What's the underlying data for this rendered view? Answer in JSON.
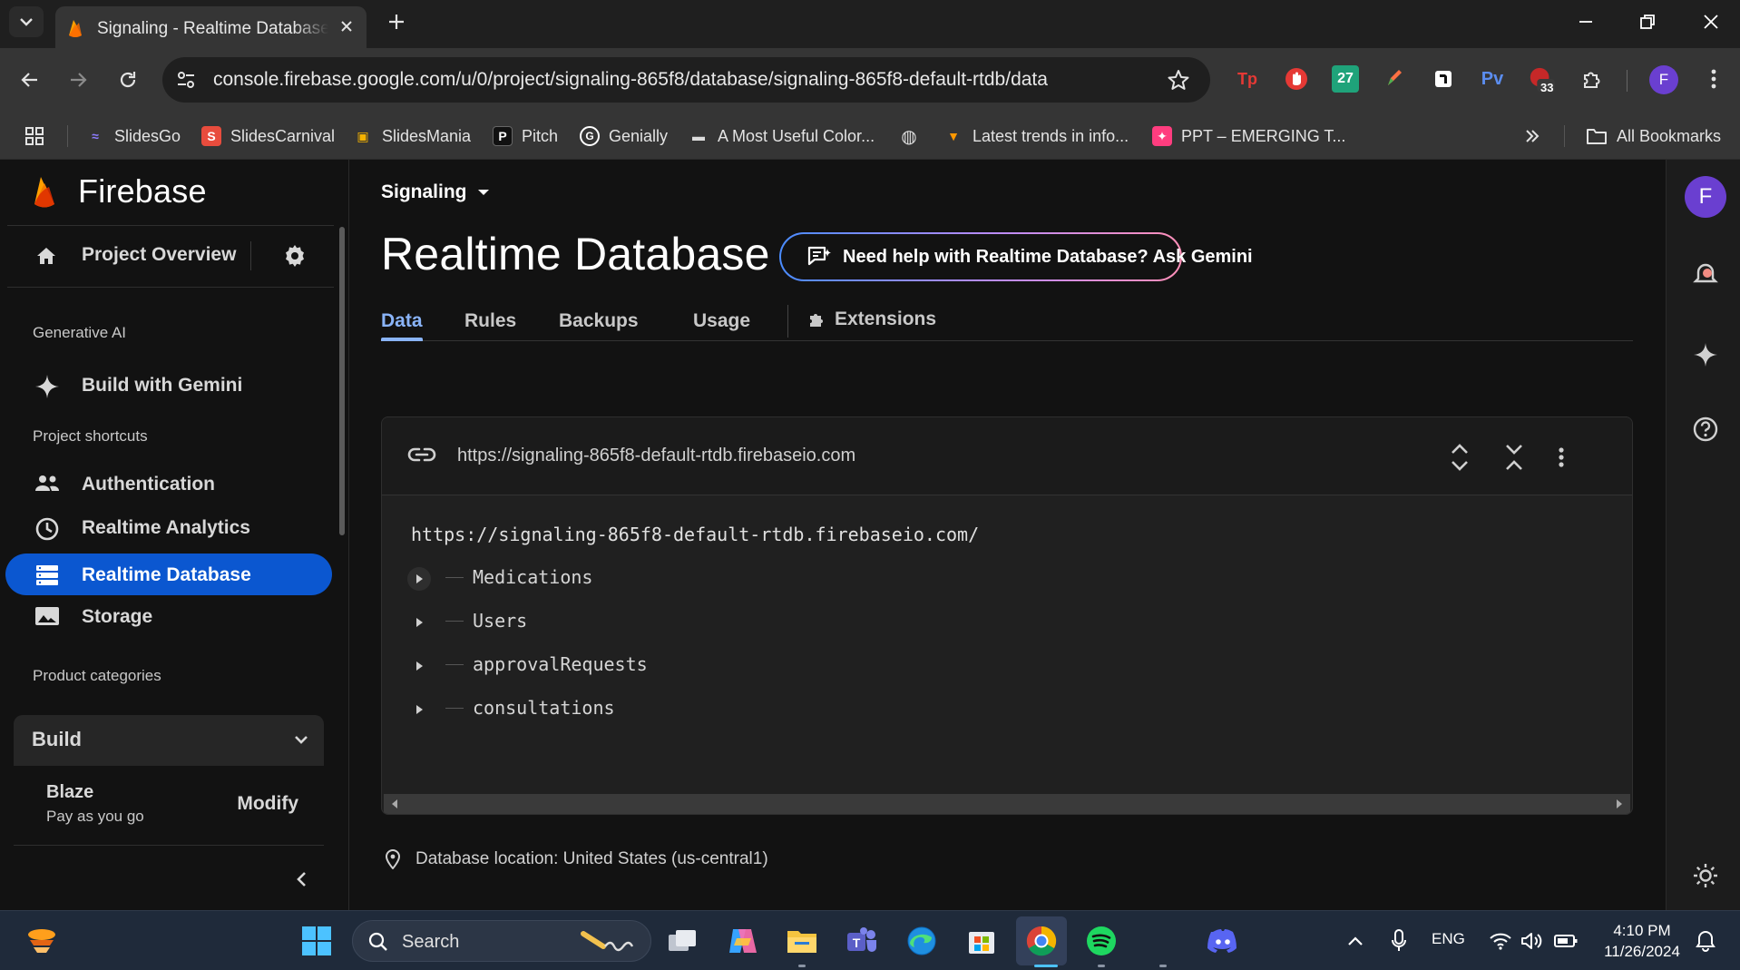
{
  "browser": {
    "tab_title": "Signaling - Realtime Database",
    "url": "console.firebase.google.com/u/0/project/signaling-865f8/database/signaling-865f8-default-rtdb/data",
    "extensions": [
      {
        "name": "tp-extension",
        "label": "Tp",
        "color": "#e53935"
      },
      {
        "name": "adblock-extension",
        "label": "",
        "color": "#e53935"
      },
      {
        "name": "calendar-27-extension",
        "label": "27",
        "color": "#1fa37a"
      },
      {
        "name": "pen-extension",
        "label": "",
        "color": "#ff7043"
      },
      {
        "name": "notion-extension",
        "label": "",
        "color": "#ffffff"
      },
      {
        "name": "pv-extension",
        "label": "Pv",
        "color": "#5b8def"
      },
      {
        "name": "badge-extension",
        "label": "33",
        "color": "#e53935"
      }
    ],
    "profile_initial": "F"
  },
  "bookmarks": {
    "items": [
      {
        "name": "bookmark-slidesgo",
        "label": "SlidesGo",
        "color": "#6c5ce7",
        "glyph": "≈"
      },
      {
        "name": "bookmark-slidescarnival",
        "label": "SlidesCarnival",
        "color": "#e84c3d",
        "glyph": "S"
      },
      {
        "name": "bookmark-slidesmania",
        "label": "SlidesMania",
        "color": "#f5b300",
        "glyph": "▣"
      },
      {
        "name": "bookmark-pitch",
        "label": "Pitch",
        "color": "#ffffff",
        "glyph": "P"
      },
      {
        "name": "bookmark-genially",
        "label": "Genially",
        "color": "#ffffff",
        "glyph": "G"
      },
      {
        "name": "bookmark-color",
        "label": "A Most Useful Color...",
        "color": "#dddddd",
        "glyph": "▬"
      },
      {
        "name": "bookmark-globe",
        "label": "",
        "color": "#dddddd",
        "glyph": "◍"
      },
      {
        "name": "bookmark-trends",
        "label": "Latest trends in info...",
        "color": "#ff9800",
        "glyph": "▼"
      },
      {
        "name": "bookmark-ppt",
        "label": "PPT – EMERGING T...",
        "color": "#ff3d7f",
        "glyph": "✦"
      }
    ],
    "all_bookmarks": "All Bookmarks"
  },
  "sidebar": {
    "brand": "Firebase",
    "project_overview": "Project Overview",
    "section_generative_ai": "Generative AI",
    "build_with_gemini": "Build with Gemini",
    "section_shortcuts": "Project shortcuts",
    "shortcuts": [
      {
        "label": "Authentication",
        "icon": "people-icon"
      },
      {
        "label": "Realtime Analytics",
        "icon": "clock-icon"
      },
      {
        "label": "Realtime Database",
        "icon": "database-icon",
        "active": true
      },
      {
        "label": "Storage",
        "icon": "image-icon"
      }
    ],
    "section_categories": "Product categories",
    "build": "Build",
    "plan_name": "Blaze",
    "plan_desc": "Pay as you go",
    "modify": "Modify"
  },
  "main": {
    "project": "Signaling",
    "title": "Realtime Database",
    "gemini_button": "Need help with Realtime Database? Ask Gemini",
    "tabs": [
      "Data",
      "Rules",
      "Backups",
      "Usage",
      "Extensions"
    ],
    "db_url": "https://signaling-865f8-default-rtdb.firebaseio.com",
    "tree_root": "https://signaling-865f8-default-rtdb.firebaseio.com/",
    "nodes": [
      "Medications",
      "Users",
      "approvalRequests",
      "consultations"
    ],
    "location": "Database location: United States (us-central1)"
  },
  "taskbar": {
    "search": "Search",
    "lang": "ENG",
    "time": "4:10 PM",
    "date": "11/26/2024"
  }
}
